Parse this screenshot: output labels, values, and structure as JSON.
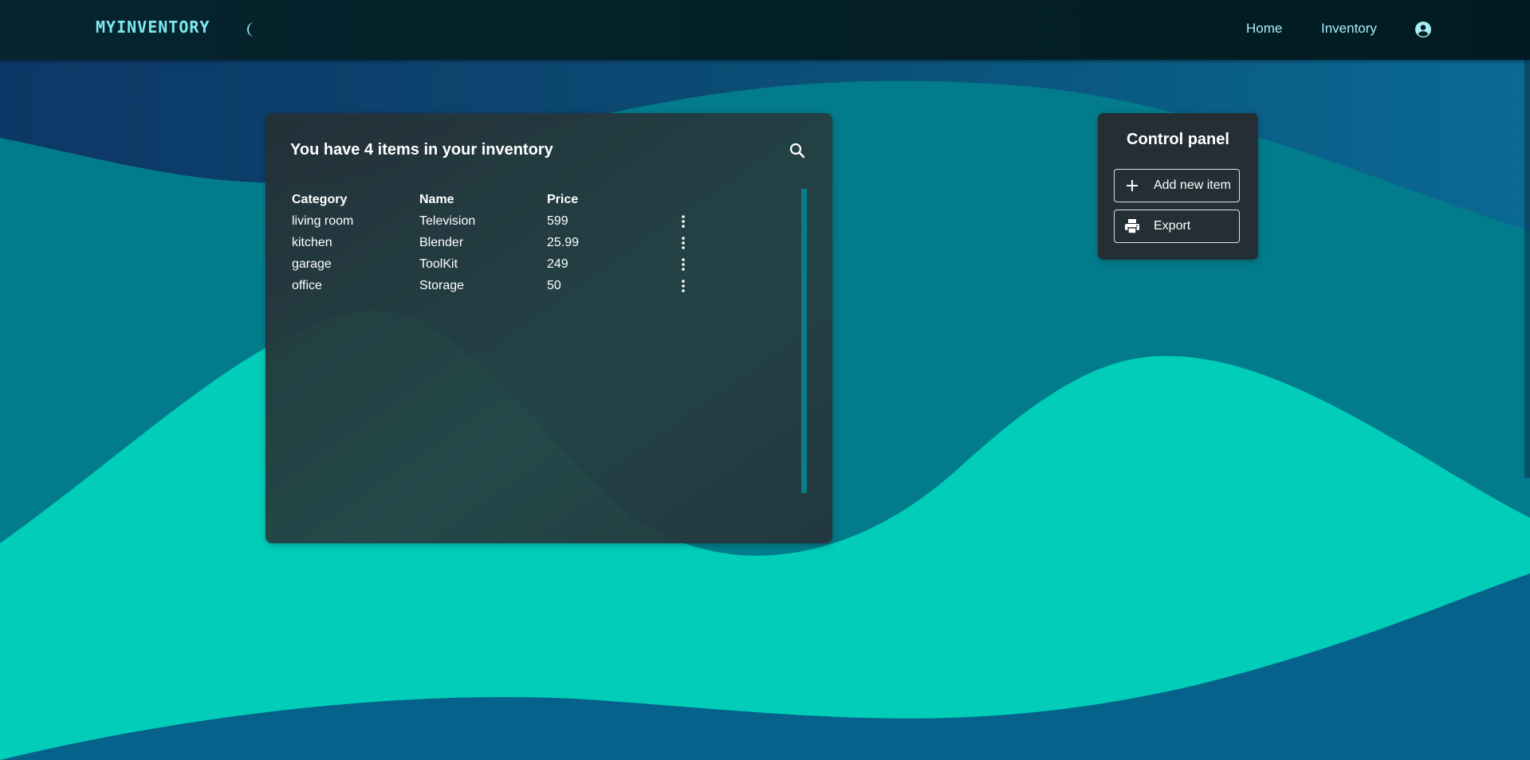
{
  "app": {
    "logo": "MYINVENTORY"
  },
  "nav": {
    "home_label": "Home",
    "inventory_label": "Inventory"
  },
  "inventory": {
    "title": "You have 4 items in your inventory",
    "columns": [
      "Category",
      "Name",
      "Price"
    ],
    "rows": [
      {
        "category": "living room",
        "name": "Television",
        "price": "599"
      },
      {
        "category": "kitchen",
        "name": "Blender",
        "price": "25.99"
      },
      {
        "category": "garage",
        "name": "ToolKit",
        "price": "249"
      },
      {
        "category": "office",
        "name": "Storage",
        "price": "50"
      }
    ]
  },
  "control_panel": {
    "title": "Control panel",
    "add_label": "Add new item",
    "export_label": "Export"
  },
  "icons": {
    "theme_toggle": "moon-icon",
    "account": "account-circle-icon",
    "search": "search-icon",
    "row_menu": "more-vert-icon",
    "add": "plus-icon",
    "export": "printer-icon"
  },
  "colors": {
    "accent": "#7fe9f0",
    "wave_light": "#00ccb4",
    "wave_mid": "#027b8c",
    "background_dark": "#0d3f66"
  }
}
